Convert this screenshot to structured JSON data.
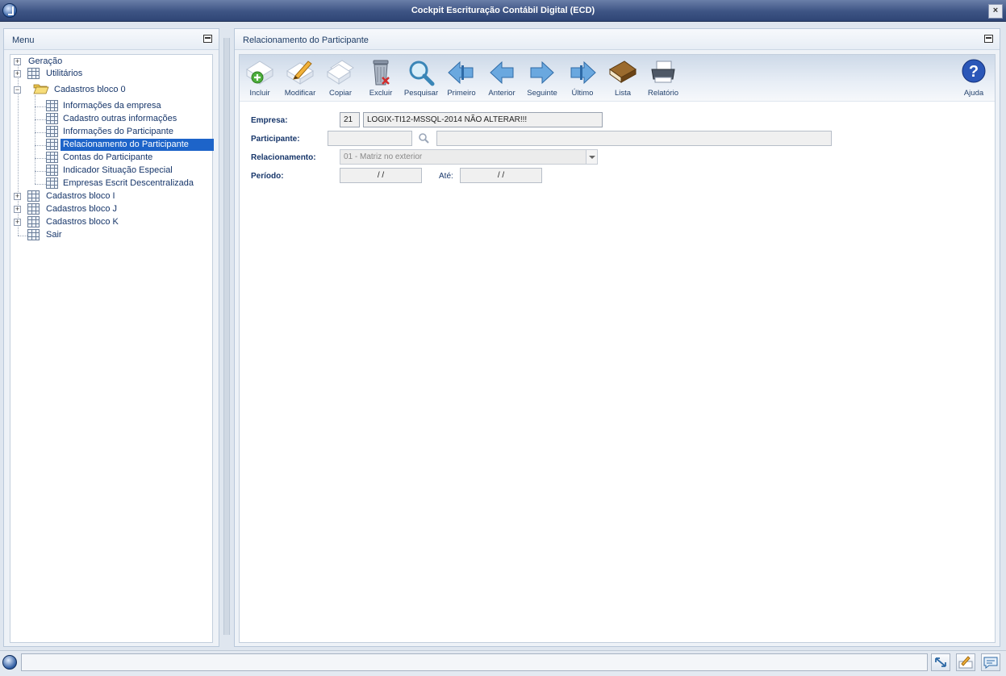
{
  "window": {
    "title": "Cockpit Escrituração Contábil Digital (ECD)",
    "close_label": "×"
  },
  "menu": {
    "title": "Menu",
    "items": [
      {
        "label": "Geração"
      },
      {
        "label": "Utilitários"
      },
      {
        "label": "Cadastros bloco 0"
      },
      {
        "label": "Informações da empresa"
      },
      {
        "label": "Cadastro outras informações"
      },
      {
        "label": "Informações do Participante"
      },
      {
        "label": "Relacionamento do Participante"
      },
      {
        "label": "Contas do Participante"
      },
      {
        "label": "Indicador Situação Especial"
      },
      {
        "label": "Empresas Escrit Descentralizada"
      },
      {
        "label": "Cadastros bloco I"
      },
      {
        "label": "Cadastros bloco J"
      },
      {
        "label": "Cadastros bloco K"
      },
      {
        "label": "Sair"
      }
    ]
  },
  "main": {
    "title": "Relacionamento do Participante"
  },
  "toolbar": {
    "incluir": "Incluir",
    "modificar": "Modificar",
    "copiar": "Copiar",
    "excluir": "Excluir",
    "pesquisar": "Pesquisar",
    "primeiro": "Primeiro",
    "anterior": "Anterior",
    "seguinte": "Seguinte",
    "ultimo": "Último",
    "lista": "Lista",
    "relatorio": "Relatório",
    "ajuda": "Ajuda"
  },
  "form": {
    "empresa_label": "Empresa:",
    "empresa_code": "21",
    "empresa_name": "LOGIX-TI12-MSSQL-2014 NÃO ALTERAR!!!",
    "participante_label": "Participante:",
    "participante_code": "",
    "participante_name": "",
    "relacionamento_label": "Relacionamento:",
    "relacionamento_value": "01 - Matriz no exterior",
    "periodo_label": "Período:",
    "periodo_inicio": " /  /",
    "ate_label": "Até:",
    "periodo_fim": " /  /"
  },
  "colors": {
    "title_bar": "#3d5484",
    "selection": "#1d64c9",
    "text": "#17366a"
  }
}
